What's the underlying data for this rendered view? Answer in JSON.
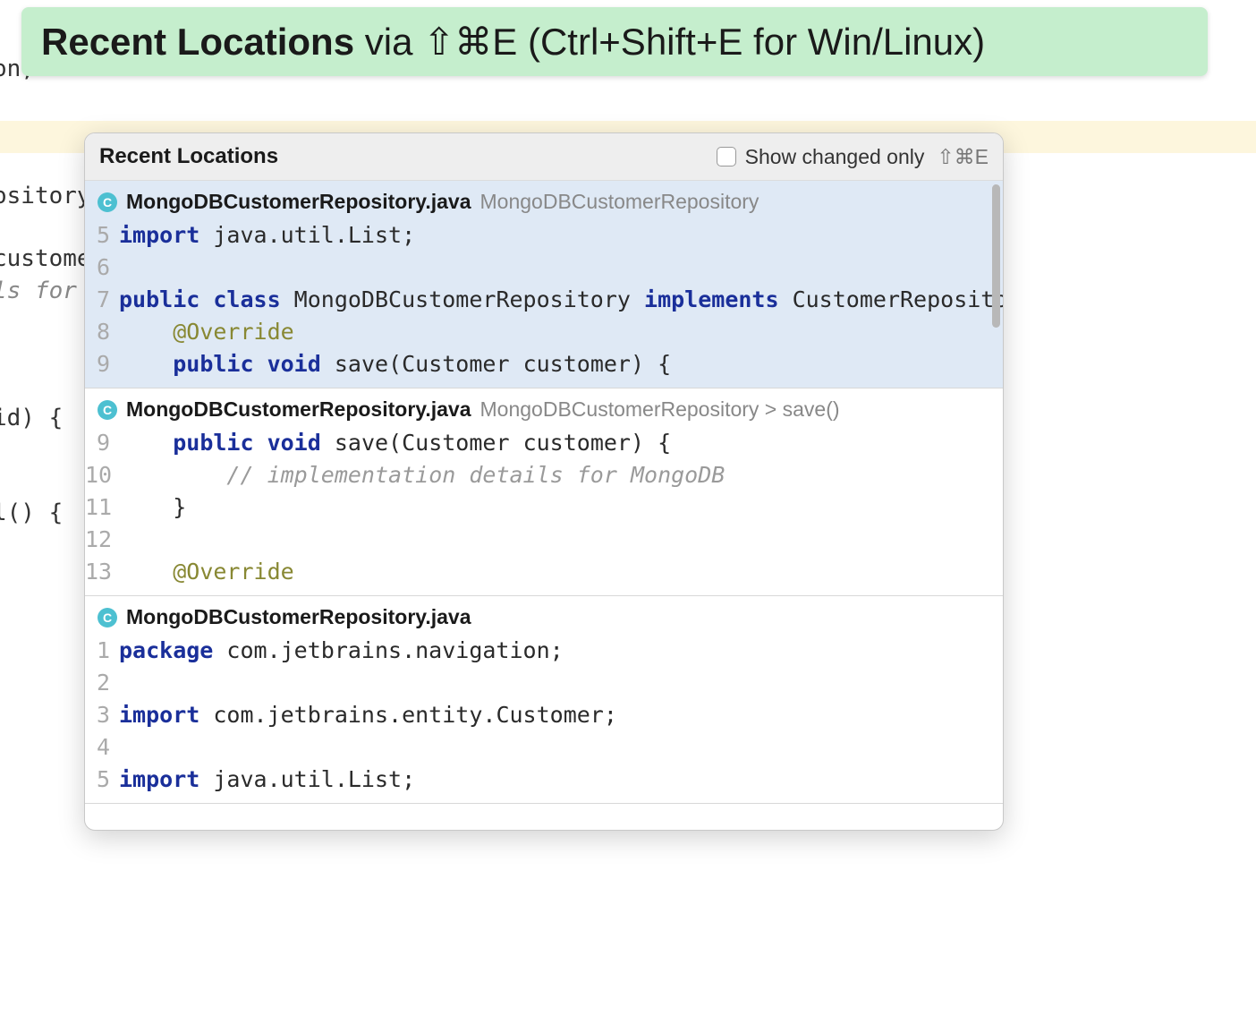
{
  "banner": {
    "title_bold": "Recent Locations",
    "title_rest": " via ⇧⌘E (Ctrl+Shift+E for Win/Linux)"
  },
  "background": {
    "on_text": "on;",
    "ository": "ository",
    "customer": "customer",
    "ls_for": "ls for",
    "id_brace": " id) {",
    "l_brace": "l() { "
  },
  "popup": {
    "title": "Recent Locations",
    "checkbox_label": "Show changed only",
    "checkbox_shortcut": "⇧⌘E"
  },
  "entries": [
    {
      "icon_letter": "C",
      "filename": "MongoDBCustomerRepository.java",
      "breadcrumb": "MongoDBCustomerRepository",
      "selected": true,
      "lines": [
        {
          "no": "5",
          "tokens": [
            {
              "t": "import",
              "c": "kw"
            },
            {
              "t": " java.util.List;",
              "c": ""
            }
          ]
        },
        {
          "no": "6",
          "tokens": [
            {
              "t": "",
              "c": ""
            }
          ]
        },
        {
          "no": "7",
          "tokens": [
            {
              "t": "public class",
              "c": "kw"
            },
            {
              "t": " MongoDBCustomerRepository ",
              "c": ""
            },
            {
              "t": "implements",
              "c": "kw"
            },
            {
              "t": " CustomerRepository {",
              "c": ""
            }
          ]
        },
        {
          "no": "8",
          "tokens": [
            {
              "t": "    ",
              "c": ""
            },
            {
              "t": "@Override",
              "c": "ann"
            }
          ]
        },
        {
          "no": "9",
          "tokens": [
            {
              "t": "    ",
              "c": ""
            },
            {
              "t": "public void",
              "c": "kw"
            },
            {
              "t": " save(Customer customer) {",
              "c": ""
            }
          ]
        }
      ]
    },
    {
      "icon_letter": "C",
      "filename": "MongoDBCustomerRepository.java",
      "breadcrumb": "MongoDBCustomerRepository > save()",
      "selected": false,
      "lines": [
        {
          "no": "9",
          "tokens": [
            {
              "t": "    ",
              "c": ""
            },
            {
              "t": "public void",
              "c": "kw"
            },
            {
              "t": " save(Customer customer) {",
              "c": ""
            }
          ]
        },
        {
          "no": "10",
          "tokens": [
            {
              "t": "        ",
              "c": ""
            },
            {
              "t": "// implementation details for MongoDB",
              "c": "cmt"
            }
          ]
        },
        {
          "no": "11",
          "tokens": [
            {
              "t": "    }",
              "c": ""
            }
          ]
        },
        {
          "no": "12",
          "tokens": [
            {
              "t": "",
              "c": ""
            }
          ]
        },
        {
          "no": "13",
          "tokens": [
            {
              "t": "    ",
              "c": ""
            },
            {
              "t": "@Override",
              "c": "ann"
            }
          ]
        }
      ]
    },
    {
      "icon_letter": "C",
      "filename": "MongoDBCustomerRepository.java",
      "breadcrumb": "",
      "selected": false,
      "lines": [
        {
          "no": "1",
          "tokens": [
            {
              "t": "package",
              "c": "kw"
            },
            {
              "t": " com.jetbrains.navigation;",
              "c": ""
            }
          ]
        },
        {
          "no": "2",
          "tokens": [
            {
              "t": "",
              "c": ""
            }
          ]
        },
        {
          "no": "3",
          "tokens": [
            {
              "t": "import",
              "c": "kw"
            },
            {
              "t": " com.jetbrains.entity.Customer;",
              "c": ""
            }
          ]
        },
        {
          "no": "4",
          "tokens": [
            {
              "t": "",
              "c": ""
            }
          ]
        },
        {
          "no": "5",
          "tokens": [
            {
              "t": "import",
              "c": "kw"
            },
            {
              "t": " java.util.List;",
              "c": ""
            }
          ]
        }
      ]
    }
  ]
}
